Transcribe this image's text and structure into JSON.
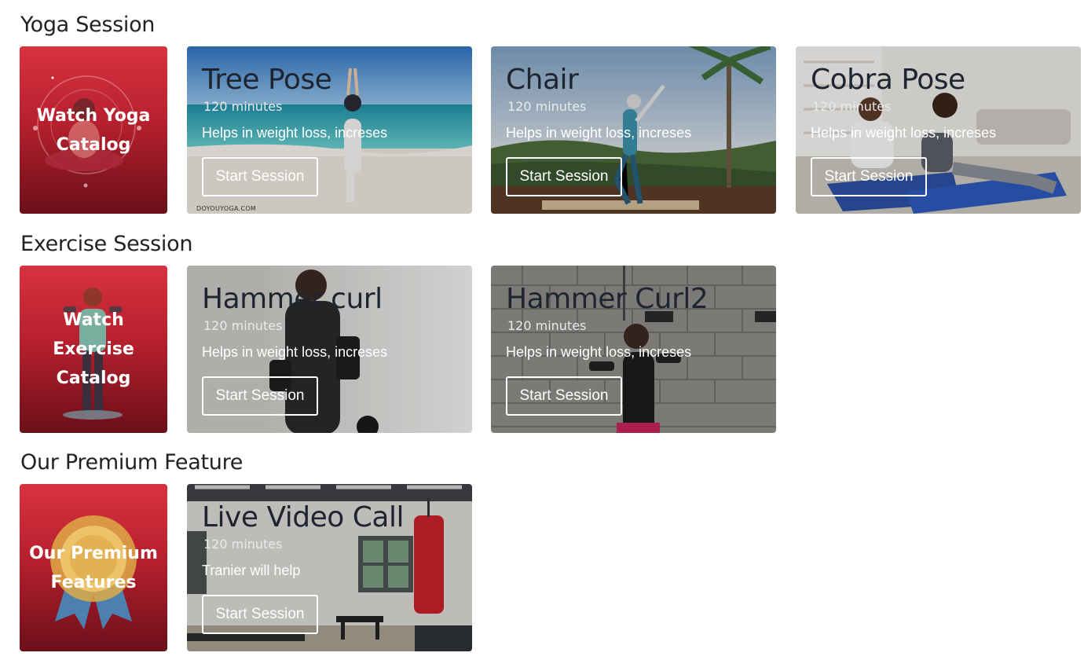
{
  "sections": {
    "yoga": {
      "title": "Yoga Session",
      "catalog_label": "Watch Yoga Catalog",
      "cards": [
        {
          "title": "Tree Pose",
          "minutes": "120 minutes",
          "desc": "Helps in weight loss, increses",
          "button": "Start Session",
          "watermark": "DOYOUYOGA.COM"
        },
        {
          "title": "Chair",
          "minutes": "120 minutes",
          "desc": "Helps in weight loss, increses",
          "button": "Start Session"
        },
        {
          "title": "Cobra Pose",
          "minutes": "120 minutes",
          "desc": "Helps in weight loss, increses",
          "button": "Start Session"
        }
      ]
    },
    "exercise": {
      "title": "Exercise Session",
      "catalog_label": "Watch Exercise Catalog",
      "cards": [
        {
          "title": "Hammer curl",
          "minutes": "120 minutes",
          "desc": "Helps in weight loss, increses",
          "button": "Start Session"
        },
        {
          "title": "Hammer Curl2",
          "minutes": "120 minutes",
          "desc": "Helps in weight loss, increses",
          "button": "Start Session"
        }
      ]
    },
    "premium": {
      "title": "Our Premium Feature",
      "catalog_label": "Our Premium Features",
      "cards": [
        {
          "title": "Live Video Call",
          "minutes": "120 minutes",
          "desc": "Tranier will help",
          "button": "Start Session"
        }
      ]
    }
  },
  "colors": {
    "catalog_top": "#d8323f",
    "catalog_bottom": "#6b0f19",
    "heading": "#222222"
  }
}
